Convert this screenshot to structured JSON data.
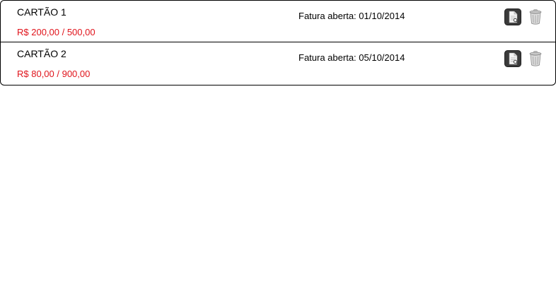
{
  "cards": [
    {
      "name": "CARTÃO 1",
      "limit": "R$ 200,00 / 500,00",
      "invoice": "Fatura aberta: 01/10/2014",
      "actions": {
        "details_icon": "document-icon",
        "delete_icon": "trash-icon"
      }
    },
    {
      "name": "CARTÃO 2",
      "limit": "R$ 80,00 / 900,00",
      "invoice": "Fatura aberta: 05/10/2014",
      "actions": {
        "details_icon": "document-icon",
        "delete_icon": "trash-icon"
      }
    }
  ],
  "colors": {
    "limit_text": "#e0131b",
    "border": "#000000",
    "icon_dark": "#3a3a3a",
    "trash_gray": "#b8b8b8"
  }
}
